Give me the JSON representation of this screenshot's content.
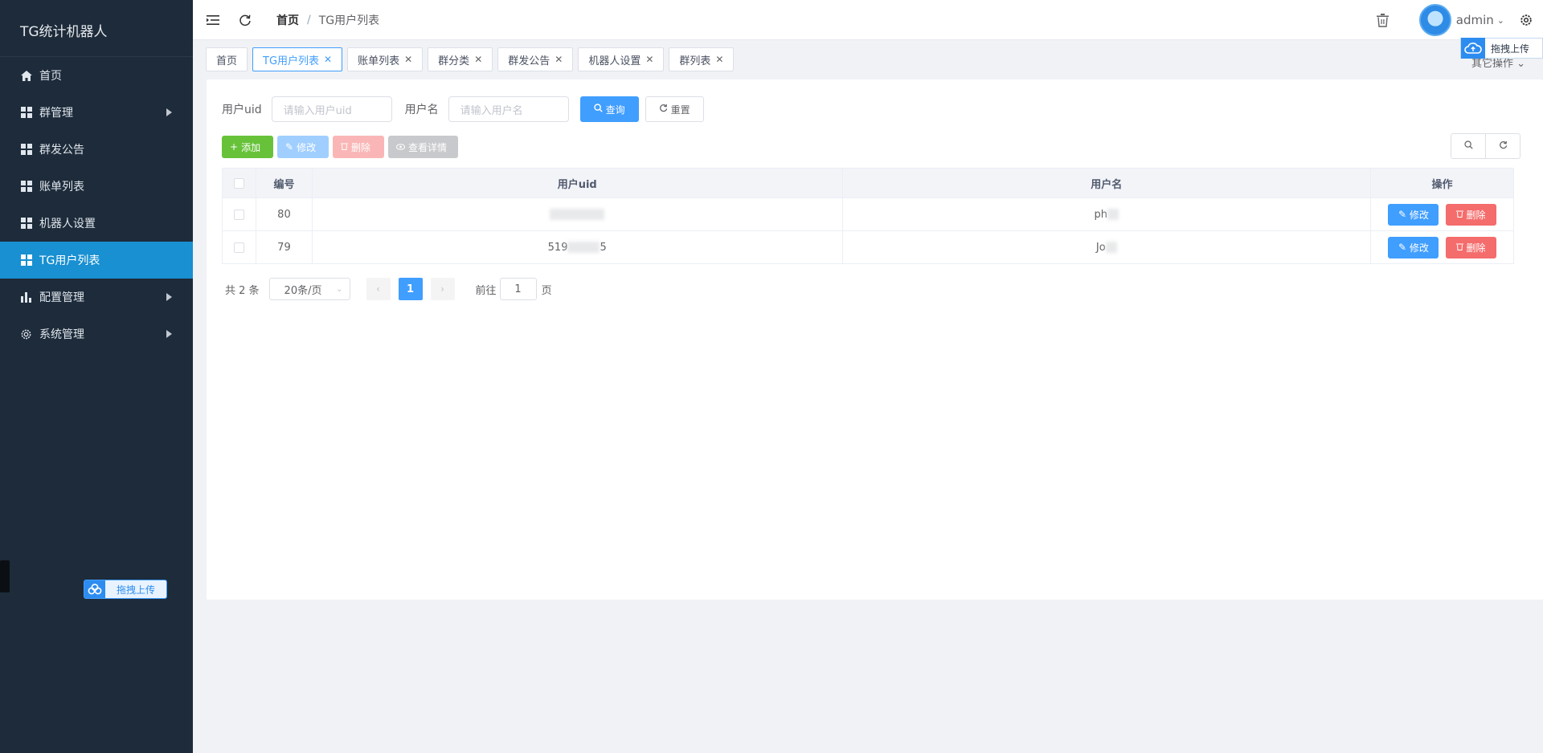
{
  "sidebar": {
    "title": "TG统计机器人",
    "items": [
      {
        "label": "首页",
        "icon": "home-icon",
        "has_children": false,
        "active": false
      },
      {
        "label": "群管理",
        "icon": "grid-icon",
        "has_children": true,
        "active": false
      },
      {
        "label": "群发公告",
        "icon": "grid-icon",
        "has_children": false,
        "active": false
      },
      {
        "label": "账单列表",
        "icon": "grid-icon",
        "has_children": false,
        "active": false
      },
      {
        "label": "机器人设置",
        "icon": "grid-icon",
        "has_children": false,
        "active": false
      },
      {
        "label": "TG用户列表",
        "icon": "grid-icon",
        "has_children": false,
        "active": true
      },
      {
        "label": "配置管理",
        "icon": "bar-chart-icon",
        "has_children": true,
        "active": false
      },
      {
        "label": "系统管理",
        "icon": "gear-icon",
        "has_children": true,
        "active": false
      }
    ],
    "upload_label": "拖拽上传"
  },
  "header": {
    "breadcrumb": [
      "首页",
      "TG用户列表"
    ],
    "username": "admin",
    "upload_label": "拖拽上传"
  },
  "tags": {
    "items": [
      {
        "label": "首页",
        "closable": false,
        "active": false
      },
      {
        "label": "TG用户列表",
        "closable": true,
        "active": true
      },
      {
        "label": "账单列表",
        "closable": true,
        "active": false
      },
      {
        "label": "群分类",
        "closable": true,
        "active": false
      },
      {
        "label": "群发公告",
        "closable": true,
        "active": false
      },
      {
        "label": "机器人设置",
        "closable": true,
        "active": false
      },
      {
        "label": "群列表",
        "closable": true,
        "active": false
      }
    ],
    "other_ops": "其它操作"
  },
  "search": {
    "uid_label": "用户uid",
    "uid_placeholder": "请输入用户uid",
    "name_label": "用户名",
    "name_placeholder": "请输入用户名",
    "query_label": "查询",
    "reset_label": "重置"
  },
  "toolbar": {
    "add_label": "添加",
    "edit_label": "修改",
    "delete_label": "删除",
    "detail_label": "查看详情"
  },
  "table": {
    "columns": [
      "编号",
      "用户uid",
      "用户名",
      "操作"
    ],
    "rows": [
      {
        "id": "80",
        "uid": "",
        "username": "ph"
      },
      {
        "id": "79",
        "uid": "519",
        "uid_suffix": "5",
        "username": "Jo"
      }
    ],
    "row_edit_label": "修改",
    "row_delete_label": "删除"
  },
  "pagination": {
    "total_text": "共 2 条",
    "page_size": "20条/页",
    "current_page": "1",
    "goto_prefix": "前往",
    "goto_value": "1",
    "goto_suffix": "页"
  },
  "colors": {
    "sidebar_bg": "#1d2b3a",
    "active_menu": "#1890d2",
    "primary": "#409eff",
    "success": "#67c23a",
    "danger": "#f56c6c"
  }
}
